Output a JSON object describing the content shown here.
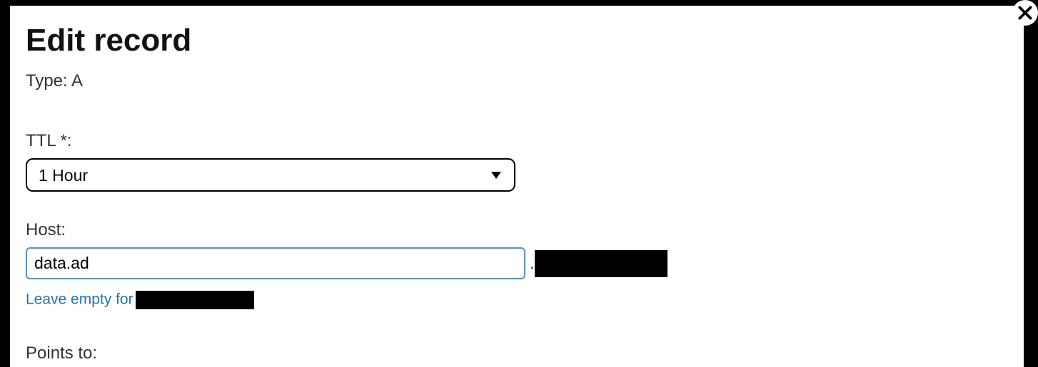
{
  "modal": {
    "title": "Edit record",
    "type_label": "Type:",
    "type_value": "A",
    "ttl_label": "TTL *:",
    "ttl_value": "1 Hour",
    "host_label": "Host:",
    "host_value": "data.ad",
    "domain_prefix": ".",
    "helper_prefix": "Leave empty for ",
    "points_to_label": "Points to:"
  }
}
